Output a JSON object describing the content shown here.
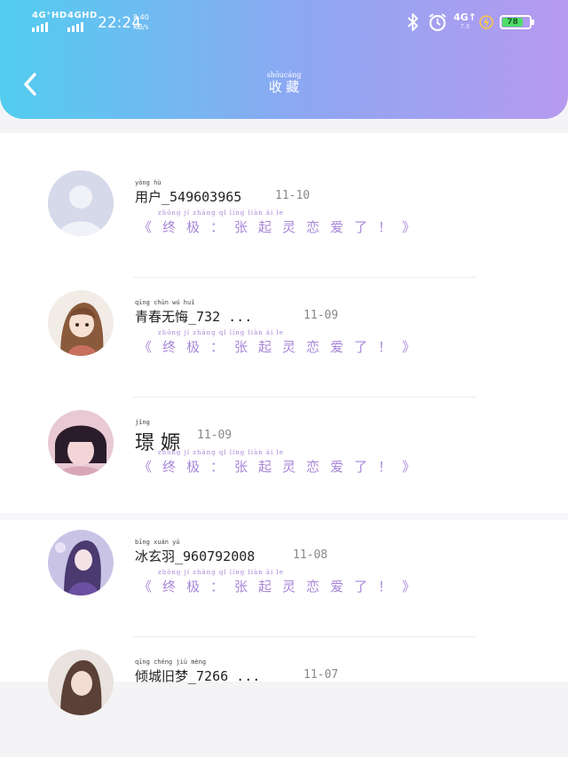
{
  "status_bar": {
    "signal1": "4G⁺HD",
    "signal2": "4GHD",
    "time": "22:24",
    "speed_value": "8.40",
    "speed_unit": "KB/s",
    "network": "4G↑",
    "network_sub": "7.6",
    "battery": "78",
    "battery_level": 0.78,
    "battery_color": "#4fdc6a"
  },
  "header": {
    "title": "收藏",
    "title_pinyin": [
      "shōu",
      "cáng"
    ],
    "back_icon": "chevron-left-icon"
  },
  "items": [
    {
      "name": "用户_549603965",
      "name_pinyin": "yòng  hù",
      "date": "11-10",
      "message": "《终极：张起灵恋爱了！》",
      "message_pinyin": "zhōng  jí    zhāng  qǐ  líng  liàn  ài  le"
    },
    {
      "name": "青春无悔_732 ...",
      "name_pinyin": "qīng  chūn  wú  huǐ",
      "date": "11-09",
      "message": "《终极：张起灵恋爱了！》",
      "message_pinyin": "zhōng  jí    zhāng  qǐ  líng  liàn  ài  le"
    },
    {
      "name": "璟 嫄",
      "name_pinyin": "jǐng",
      "date": "11-09",
      "message": "《终极：张起灵恋爱了！》",
      "message_pinyin": "zhōng  jí    zhāng  qǐ  líng  liàn  ài  le"
    },
    {
      "name": "冰玄羽_960792008",
      "name_pinyin": "bīng  xuán  yǔ",
      "date": "11-08",
      "message": "《终极：张起灵恋爱了！》",
      "message_pinyin": "zhōng  jí    zhāng  qǐ  líng  liàn  ài  le"
    },
    {
      "name": "倾城旧梦_7266 ...",
      "name_pinyin": "qīng  chéng  jiù  mèng",
      "date": "11-07",
      "message": "",
      "message_pinyin": ""
    }
  ]
}
